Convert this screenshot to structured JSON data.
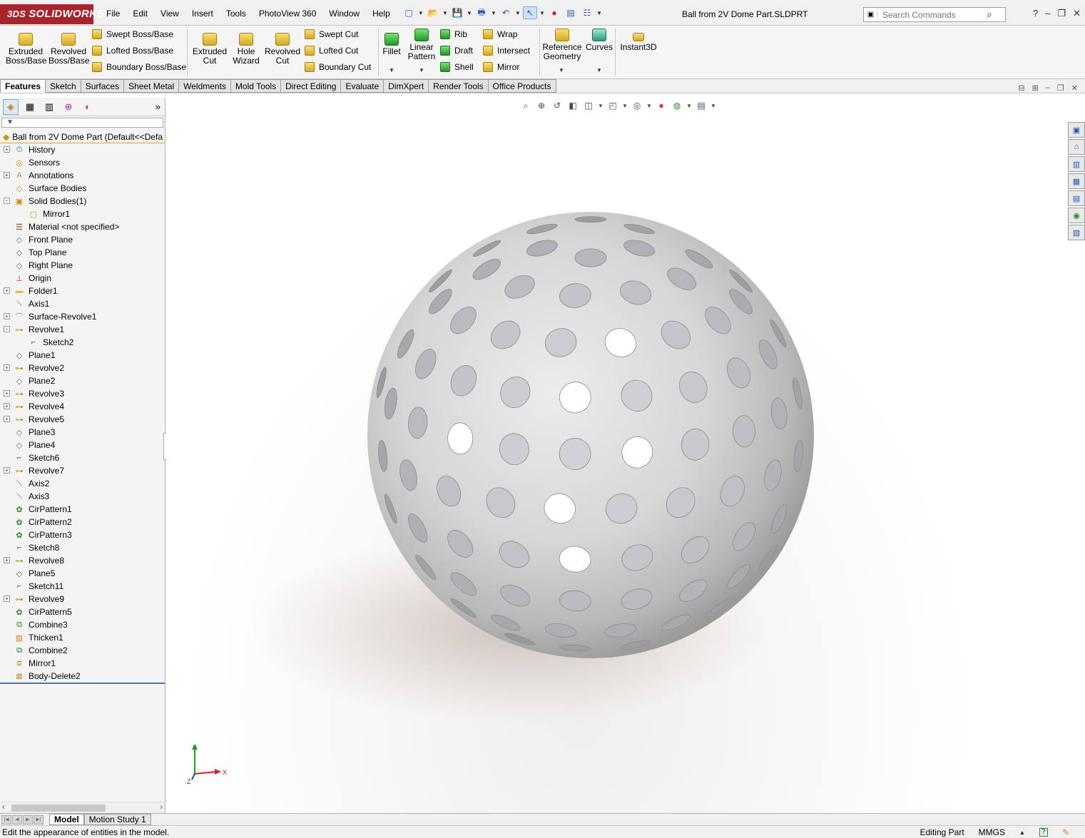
{
  "app": {
    "brand": "SOLIDWORKS",
    "document_title": "Ball from 2V Dome Part.SLDPRT"
  },
  "menu": [
    "File",
    "Edit",
    "View",
    "Insert",
    "Tools",
    "PhotoView 360",
    "Window",
    "Help"
  ],
  "search": {
    "placeholder": "Search Commands"
  },
  "commands": {
    "extruded_boss": "Extruded\nBoss/Base",
    "revolved_boss": "Revolved\nBoss/Base",
    "swept_boss": "Swept Boss/Base",
    "lofted_boss": "Lofted Boss/Base",
    "boundary_boss": "Boundary Boss/Base",
    "extruded_cut": "Extruded\nCut",
    "hole_wizard": "Hole\nWizard",
    "revolved_cut": "Revolved\nCut",
    "swept_cut": "Swept Cut",
    "lofted_cut": "Lofted Cut",
    "boundary_cut": "Boundary Cut",
    "fillet": "Fillet",
    "linear_pattern": "Linear\nPattern",
    "rib": "Rib",
    "draft": "Draft",
    "shell": "Shell",
    "wrap": "Wrap",
    "intersect": "Intersect",
    "mirror": "Mirror",
    "reference_geometry": "Reference\nGeometry",
    "curves": "Curves",
    "instant3d": "Instant3D"
  },
  "tabs": [
    "Features",
    "Sketch",
    "Surfaces",
    "Sheet Metal",
    "Weldments",
    "Mold Tools",
    "Direct Editing",
    "Evaluate",
    "DimXpert",
    "Render Tools",
    "Office Products"
  ],
  "active_tab": "Features",
  "feature_tree": {
    "root": "Ball from 2V Dome Part  (Default<<Defa",
    "items": [
      {
        "label": "History",
        "icon": "history-icon",
        "expandable": true
      },
      {
        "label": "Sensors",
        "icon": "sensors-icon",
        "expandable": false
      },
      {
        "label": "Annotations",
        "icon": "annotations-icon",
        "expandable": true
      },
      {
        "label": "Surface Bodies",
        "icon": "surface-bodies-icon",
        "expandable": false
      },
      {
        "label": "Solid Bodies(1)",
        "icon": "solid-bodies-icon",
        "expandable": true,
        "expanded": true
      },
      {
        "label": "Mirror1",
        "icon": "body-icon",
        "child": true
      },
      {
        "label": "Material <not specified>",
        "icon": "material-icon",
        "expandable": false
      },
      {
        "label": "Front Plane",
        "icon": "plane-icon"
      },
      {
        "label": "Top Plane",
        "icon": "plane-icon"
      },
      {
        "label": "Right Plane",
        "icon": "plane-icon"
      },
      {
        "label": "Origin",
        "icon": "origin-icon"
      },
      {
        "label": "Folder1",
        "icon": "folder-icon",
        "expandable": true
      },
      {
        "label": "Axis1",
        "icon": "axis-icon"
      },
      {
        "label": "Surface-Revolve1",
        "icon": "surface-revolve-icon",
        "expandable": true
      },
      {
        "label": "Revolve1",
        "icon": "revolve-icon",
        "expandable": true,
        "expanded": true
      },
      {
        "label": "Sketch2",
        "icon": "sketch-icon",
        "child": true
      },
      {
        "label": "Plane1",
        "icon": "plane-icon"
      },
      {
        "label": "Revolve2",
        "icon": "revolve-icon",
        "expandable": true
      },
      {
        "label": "Plane2",
        "icon": "plane-icon"
      },
      {
        "label": "Revolve3",
        "icon": "revolve-icon",
        "expandable": true
      },
      {
        "label": "Revolve4",
        "icon": "revolve-icon",
        "expandable": true
      },
      {
        "label": "Revolve5",
        "icon": "revolve-icon",
        "expandable": true
      },
      {
        "label": "Plane3",
        "icon": "plane-icon"
      },
      {
        "label": "Plane4",
        "icon": "plane-icon"
      },
      {
        "label": "Sketch6",
        "icon": "sketch-icon"
      },
      {
        "label": "Revolve7",
        "icon": "revolve-icon",
        "expandable": true
      },
      {
        "label": "Axis2",
        "icon": "axis-icon"
      },
      {
        "label": "Axis3",
        "icon": "axis-icon"
      },
      {
        "label": "CirPattern1",
        "icon": "circular-pattern-icon"
      },
      {
        "label": "CirPattern2",
        "icon": "circular-pattern-icon"
      },
      {
        "label": "CirPattern3",
        "icon": "circular-pattern-icon"
      },
      {
        "label": "Sketch8",
        "icon": "sketch-icon"
      },
      {
        "label": "Revolve8",
        "icon": "revolve-icon",
        "expandable": true
      },
      {
        "label": "Plane5",
        "icon": "plane-icon"
      },
      {
        "label": "Sketch11",
        "icon": "sketch-icon"
      },
      {
        "label": "Revolve9",
        "icon": "revolve-icon",
        "expandable": true
      },
      {
        "label": "CirPattern5",
        "icon": "circular-pattern-icon"
      },
      {
        "label": "Combine3",
        "icon": "combine-icon"
      },
      {
        "label": "Thicken1",
        "icon": "thicken-icon"
      },
      {
        "label": "Combine2",
        "icon": "combine-icon"
      },
      {
        "label": "Mirror1",
        "icon": "mirror-icon"
      },
      {
        "label": "Body-Delete2",
        "icon": "body-delete-icon"
      }
    ]
  },
  "bottom_tabs": [
    "Model",
    "Motion Study 1"
  ],
  "active_bottom_tab": "Model",
  "status": {
    "message": "Edit the appearance of entities in the model.",
    "mode": "Editing Part",
    "units": "MMGS"
  },
  "triad": {
    "x_label": "X",
    "y_label": "Y",
    "z_label": "Z"
  },
  "colors": {
    "brand_red": "#a8242a",
    "selection_blue": "#3c78c8",
    "ball_grey": "#c8c8c8"
  }
}
